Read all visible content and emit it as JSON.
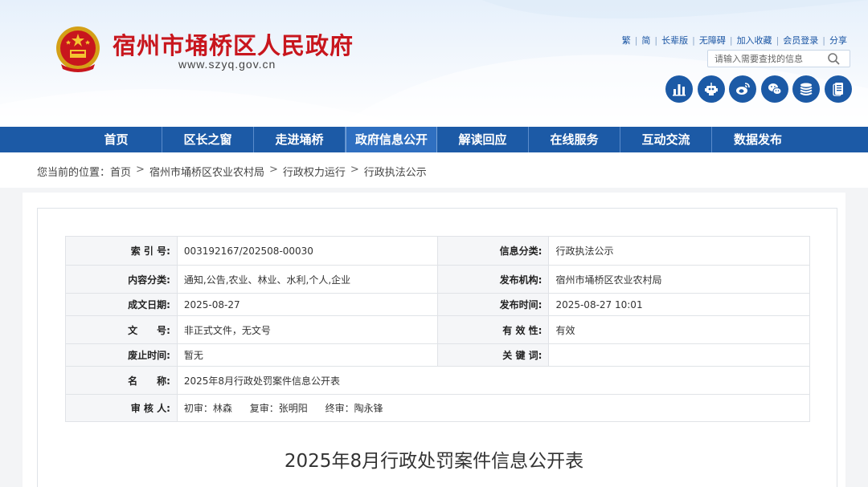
{
  "header": {
    "site_name": "宿州市埇桥区人民政府",
    "domain": "www.szyq.gov.cn",
    "top_links": [
      "繁",
      "简",
      "长辈版",
      "无障碍",
      "加入收藏",
      "会员登录",
      "分享"
    ],
    "search_placeholder": "请输入需要查找的信息",
    "icons": [
      "chart-icon",
      "robot-icon",
      "weibo-icon",
      "wechat-icon",
      "database-icon",
      "mobile-app-icon"
    ]
  },
  "nav": {
    "items": [
      "首页",
      "区长之窗",
      "走进埇桥",
      "政府信息公开",
      "解读回应",
      "在线服务",
      "互动交流",
      "数据发布"
    ],
    "active": "政府信息公开"
  },
  "breadcrumb": {
    "prefix": "您当前的位置：",
    "items": [
      "首页",
      "宿州市埇桥区农业农村局",
      "行政权力运行",
      "行政执法公示"
    ],
    "separator": ">"
  },
  "meta": {
    "index_label": "索 引 号:",
    "index_value": "003192167/202508-00030",
    "info_category_label": "信息分类:",
    "info_category_value": "行政执法公示",
    "content_category_label": "内容分类:",
    "content_category_value": "通知,公告,农业、林业、水利,个人,企业",
    "publisher_label": "发布机构:",
    "publisher_value": "宿州市埇桥区农业农村局",
    "created_label": "成文日期:",
    "created_value": "2025-08-27",
    "published_label": "发布时间:",
    "published_value": "2025-08-27 10:01",
    "doc_no_label": "文　　号:",
    "doc_no_value": "非正式文件，无文号",
    "validity_label": "有 效 性:",
    "validity_value": "有效",
    "expiry_label": "废止时间:",
    "expiry_value": "暂无",
    "keywords_label": "关 键 词:",
    "keywords_value": "",
    "name_label": "名　　称:",
    "name_value": "2025年8月行政处罚案件信息公开表",
    "review_label": "审 核 人:",
    "review_first": "初审：林森",
    "review_second": "复审：张明阳",
    "review_final": "终审：陶永锋"
  },
  "document": {
    "title": "2025年8月行政处罚案件信息公开表"
  },
  "colors": {
    "brand_red": "#c8161d",
    "nav_blue": "#1c5aa6",
    "nav_active": "#2f6fc0"
  }
}
